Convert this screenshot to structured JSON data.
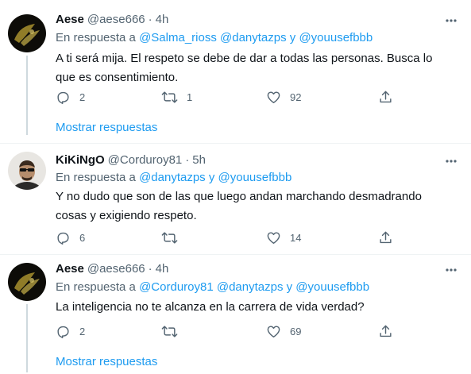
{
  "tweets": [
    {
      "name": "Aese",
      "handle": "@aese666",
      "time": "4h",
      "reply_prefix": "En respuesta a",
      "mentions_text": "@Salma_rioss @danytazps y @youusefbbb",
      "text": "A ti será mija. El respeto se debe de dar a todas las personas. Busca lo que es consentimiento.",
      "replies": "2",
      "retweets": "1",
      "likes": "92",
      "show_replies": "Mostrar respuestas"
    },
    {
      "name": "KiKiNgO",
      "handle": "@Corduroy81",
      "time": "5h",
      "reply_prefix": "En respuesta a",
      "mentions_text": "@danytazps y @youusefbbb",
      "text": "Y no dudo que son de las que luego andan marchando desmadrando cosas y exigiendo respeto.",
      "replies": "6",
      "retweets": "",
      "likes": "14"
    },
    {
      "name": "Aese",
      "handle": "@aese666",
      "time": "4h",
      "reply_prefix": "En respuesta a",
      "mentions_text": "@Corduroy81 @danytazps y @youusefbbb",
      "text": "La inteligencia no te alcanza en la carrera de vida verdad?",
      "replies": "2",
      "retweets": "",
      "likes": "69",
      "show_replies": "Mostrar respuestas"
    }
  ],
  "colors": {
    "link": "#1d9bf0",
    "secondary": "#536471",
    "text": "#0f1419",
    "border": "#eff3f4"
  },
  "icons": [
    "reply-icon",
    "retweet-icon",
    "like-icon",
    "share-icon",
    "more-icon"
  ]
}
